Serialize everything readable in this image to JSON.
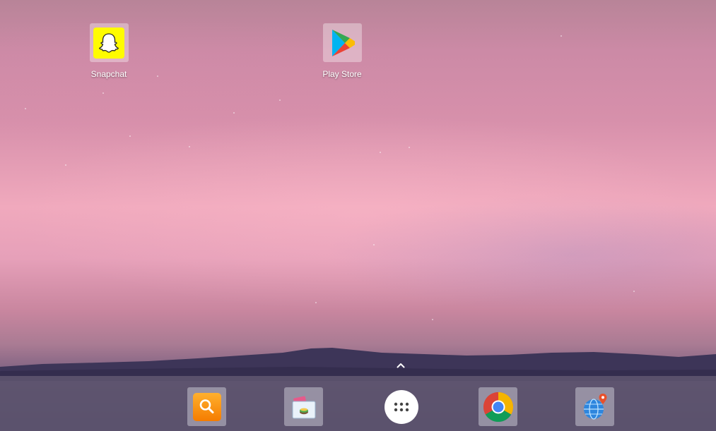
{
  "desktop": {
    "apps": [
      {
        "label": "Snapchat",
        "icon": "snapchat-icon"
      },
      {
        "label": "Play Store",
        "icon": "play-store-icon"
      }
    ]
  },
  "dock": {
    "apps": [
      {
        "icon": "search-icon"
      },
      {
        "icon": "gallery-icon"
      },
      {
        "icon": "app-drawer-icon"
      },
      {
        "icon": "chrome-icon"
      },
      {
        "icon": "maps-globe-icon"
      }
    ],
    "drawer_hint": "chevron-up-icon"
  },
  "colors": {
    "snapchat_yellow": "#FFFC00",
    "search_orange": "#F7931E",
    "dock_background": "#5C546E"
  }
}
